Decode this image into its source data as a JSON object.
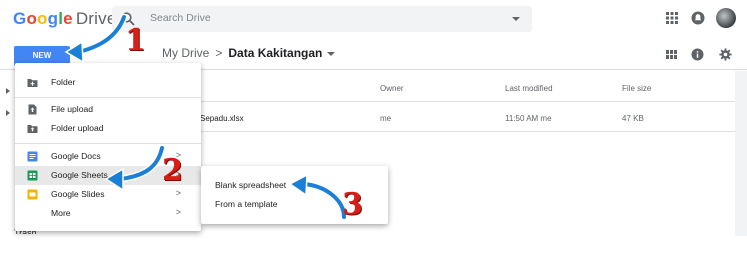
{
  "header": {
    "logo_google": "Google",
    "logo_drive": "Drive",
    "search_placeholder": "Search Drive"
  },
  "toolbar": {
    "new_label": "NEW",
    "breadcrumb_root": "My Drive",
    "breadcrumb_sep": ">",
    "breadcrumb_current": "Data Kakitangan"
  },
  "file_list": {
    "columns": {
      "owner": "Owner",
      "last_modified": "Last modified",
      "file_size": "File size"
    },
    "rows": [
      {
        "name": "Sepadu.xlsx",
        "owner": "me",
        "last_modified": "11:50 AM  me",
        "file_size": "47 KB"
      }
    ]
  },
  "new_menu": {
    "items": [
      {
        "label": "Folder",
        "icon": "folder-plus-icon",
        "color": "#5f6368"
      },
      {
        "label": "File upload",
        "icon": "file-upload-icon",
        "color": "#5f6368"
      },
      {
        "label": "Folder upload",
        "icon": "folder-upload-icon",
        "color": "#5f6368"
      },
      {
        "label": "Google Docs",
        "icon": "google-docs-icon",
        "color": "#4285f4",
        "chevron": ">"
      },
      {
        "label": "Google Sheets",
        "icon": "google-sheets-icon",
        "color": "#0f9d58",
        "chevron": ">"
      },
      {
        "label": "Google Slides",
        "icon": "google-slides-icon",
        "color": "#f4b400",
        "chevron": ">"
      },
      {
        "label": "More",
        "icon": "",
        "color": "",
        "chevron": ">"
      }
    ]
  },
  "sheets_submenu": {
    "items": [
      {
        "label": "Blank spreadsheet"
      },
      {
        "label": "From a template"
      }
    ]
  },
  "annotations": {
    "step1": "1",
    "step2": "2",
    "step3": "3",
    "color": "#d91e18",
    "arrow_color": "#1a7fd6"
  },
  "sidebar": {
    "bottom_label_fragment": "Trash"
  }
}
